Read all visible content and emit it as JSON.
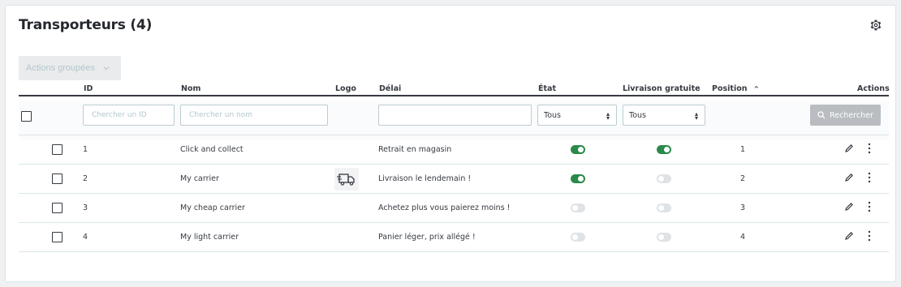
{
  "header": {
    "title": "Transporteurs (4)",
    "settings_icon": "gear-icon"
  },
  "bulk_actions": {
    "label": "Actions groupées"
  },
  "columns": {
    "id": "ID",
    "name": "Nom",
    "logo": "Logo",
    "delay": "Délai",
    "state": "État",
    "free_shipping": "Livraison gratuite",
    "position": "Position",
    "actions": "Actions"
  },
  "filters": {
    "id_placeholder": "Chercher un ID",
    "name_placeholder": "Chercher un nom",
    "delay_value": "",
    "state_value": "Tous",
    "free_shipping_value": "Tous",
    "search_label": "Rechercher"
  },
  "rows": [
    {
      "id": "1",
      "name": "Click and collect",
      "has_logo": false,
      "delay": "Retrait en magasin",
      "state": true,
      "free_shipping": true,
      "position": "1"
    },
    {
      "id": "2",
      "name": "My carrier",
      "has_logo": true,
      "delay": "Livraison le lendemain !",
      "state": true,
      "free_shipping": false,
      "position": "2"
    },
    {
      "id": "3",
      "name": "My cheap carrier",
      "has_logo": false,
      "delay": "Achetez plus vous paierez moins !",
      "state": false,
      "free_shipping": false,
      "position": "3"
    },
    {
      "id": "4",
      "name": "My light carrier",
      "has_logo": false,
      "delay": "Panier léger, prix allégé !",
      "state": false,
      "free_shipping": false,
      "position": "4"
    }
  ],
  "colors": {
    "toggle_on": "#2a8a4a",
    "toggle_off": "#dfe3e6",
    "search_button": "#b9bdc1"
  }
}
